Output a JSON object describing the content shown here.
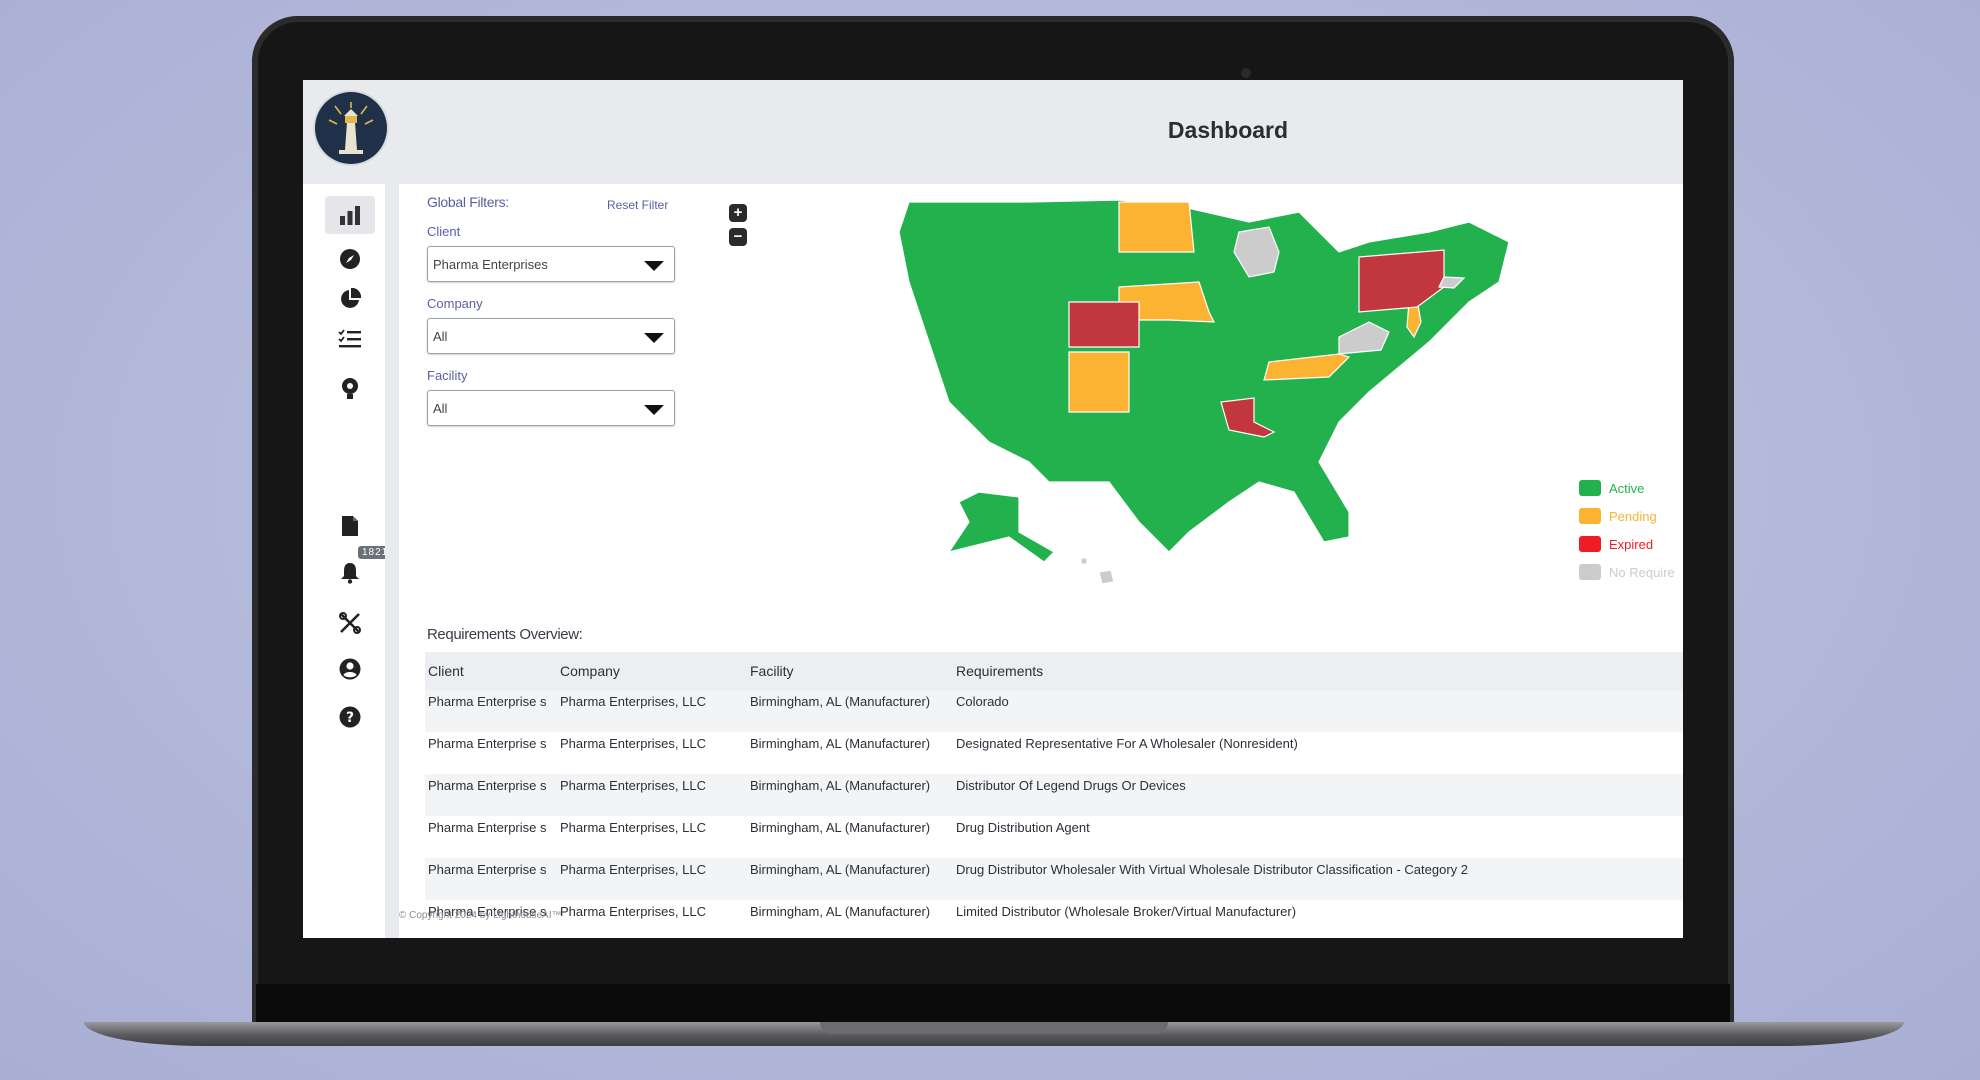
{
  "header": {
    "title": "Dashboard"
  },
  "sidebar": {
    "items": [
      {
        "name": "dashboard",
        "icon": "bar-chart-icon",
        "active": true
      },
      {
        "name": "explore",
        "icon": "compass-icon"
      },
      {
        "name": "reports",
        "icon": "pie-chart-icon"
      },
      {
        "name": "checklist",
        "icon": "checklist-icon"
      },
      {
        "name": "insights",
        "icon": "lightbulb-icon"
      },
      {
        "name": "documents",
        "icon": "document-icon"
      },
      {
        "name": "notifications",
        "icon": "bell-icon",
        "badge": "1821"
      },
      {
        "name": "tools",
        "icon": "tools-icon"
      },
      {
        "name": "profile",
        "icon": "user-circle-icon"
      },
      {
        "name": "help",
        "icon": "help-circle-icon"
      }
    ]
  },
  "filters": {
    "title": "Global Filters:",
    "reset_label": "Reset Filter",
    "client": {
      "label": "Client",
      "value": "Pharma Enterprises"
    },
    "company": {
      "label": "Company",
      "value": "All"
    },
    "facility": {
      "label": "Facility",
      "value": "All"
    }
  },
  "map": {
    "zoom_in": "+",
    "zoom_out": "−",
    "colors": {
      "active": "#22b14c",
      "pending": "#fbb331",
      "expired": "#c1373d",
      "expired_swatch": "#ee1c24",
      "no_requirement": "#cccccc",
      "border": "#ffffff"
    },
    "legend": [
      {
        "label": "Active",
        "color": "#22b14c"
      },
      {
        "label": "Pending",
        "color": "#fbb331"
      },
      {
        "label": "Expired",
        "color": "#ee1c24"
      },
      {
        "label": "No Require",
        "color": "#cccccc"
      }
    ]
  },
  "requirements": {
    "title": "Requirements Overview:",
    "columns": [
      "Client",
      "Company",
      "Facility",
      "Requirements"
    ],
    "rows": [
      {
        "client": "Pharma Enterprise s",
        "company": "Pharma Enterprises, LLC",
        "facility": "Birmingham, AL (Manufacturer)",
        "requirement": "Colorado"
      },
      {
        "client": "Pharma Enterprise s",
        "company": "Pharma Enterprises, LLC",
        "facility": "Birmingham, AL (Manufacturer)",
        "requirement": "Designated Representative For A Wholesaler (Nonresident)"
      },
      {
        "client": "Pharma Enterprise s",
        "company": "Pharma Enterprises, LLC",
        "facility": "Birmingham, AL (Manufacturer)",
        "requirement": "Distributor Of Legend Drugs Or Devices"
      },
      {
        "client": "Pharma Enterprise s",
        "company": "Pharma Enterprises, LLC",
        "facility": "Birmingham, AL (Manufacturer)",
        "requirement": "Drug Distribution Agent"
      },
      {
        "client": "Pharma Enterprise s",
        "company": "Pharma Enterprises, LLC",
        "facility": "Birmingham, AL (Manufacturer)",
        "requirement": "Drug Distributor Wholesaler With Virtual Wholesale Distributor Classification - Category 2"
      },
      {
        "client": "Pharma Enterprise s",
        "company": "Pharma Enterprises, LLC",
        "facility": "Birmingham, AL (Manufacturer)",
        "requirement": "Limited Distributor (Wholesale Broker/Virtual Manufacturer)"
      }
    ]
  },
  "footer": {
    "text": "© Copyright 2024 by LighthouseAI™"
  }
}
